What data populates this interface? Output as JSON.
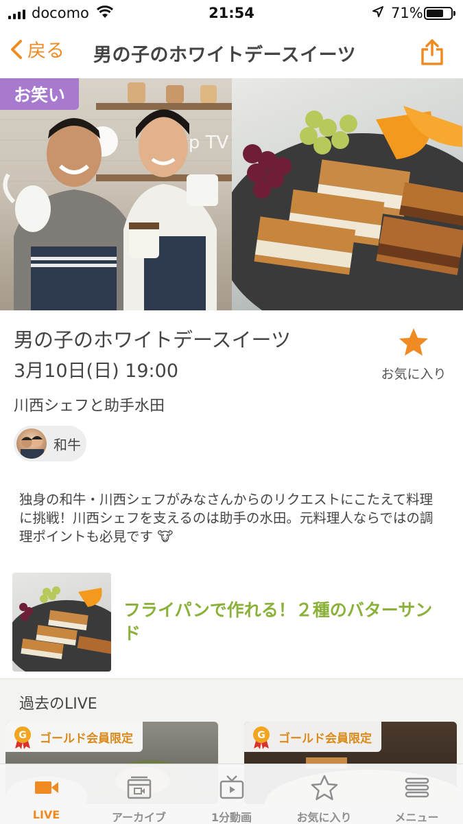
{
  "status_bar": {
    "carrier": "docomo",
    "time": "21:54",
    "battery": "71%",
    "battery_level": 0.71
  },
  "nav": {
    "back_label": "戻る",
    "title": "男の子のホワイトデースイーツ"
  },
  "hero": {
    "badge": "お笑い"
  },
  "program": {
    "title": "男の子のホワイトデースイーツ",
    "datetime": "3月10日(日) 19:00",
    "favorite_label": "お気に入り",
    "subtitle": "川西シェフと助手水田",
    "performer": "和牛",
    "description": "独身の和牛・川西シェフがみなさんからのリクエストにこたえて料理に挑戦！川西シェフを支えるのは助手の水田。元料理人ならではの調理ポイントも必見です 🐮"
  },
  "recipe": {
    "title": "フライパンで作れる！２種のバターサンド"
  },
  "past_live": {
    "heading": "過去のLIVE",
    "cards": [
      {
        "badge": "ゴールド会員限定"
      },
      {
        "badge": "ゴールド会員限定"
      }
    ]
  },
  "tabs": [
    {
      "label": "LIVE",
      "icon": "video-camera-icon",
      "active": true
    },
    {
      "label": "アーカイブ",
      "icon": "archive-icon",
      "active": false
    },
    {
      "label": "1分動画",
      "icon": "tv-icon",
      "active": false
    },
    {
      "label": "お気に入り",
      "icon": "star-outline-icon",
      "active": false
    },
    {
      "label": "メニュー",
      "icon": "menu-icon",
      "active": false
    }
  ],
  "colors": {
    "accent": "#f08b24",
    "badge_purple": "#a77ad0",
    "recipe_green": "#8ab23a",
    "gold": "#d98a1a"
  }
}
